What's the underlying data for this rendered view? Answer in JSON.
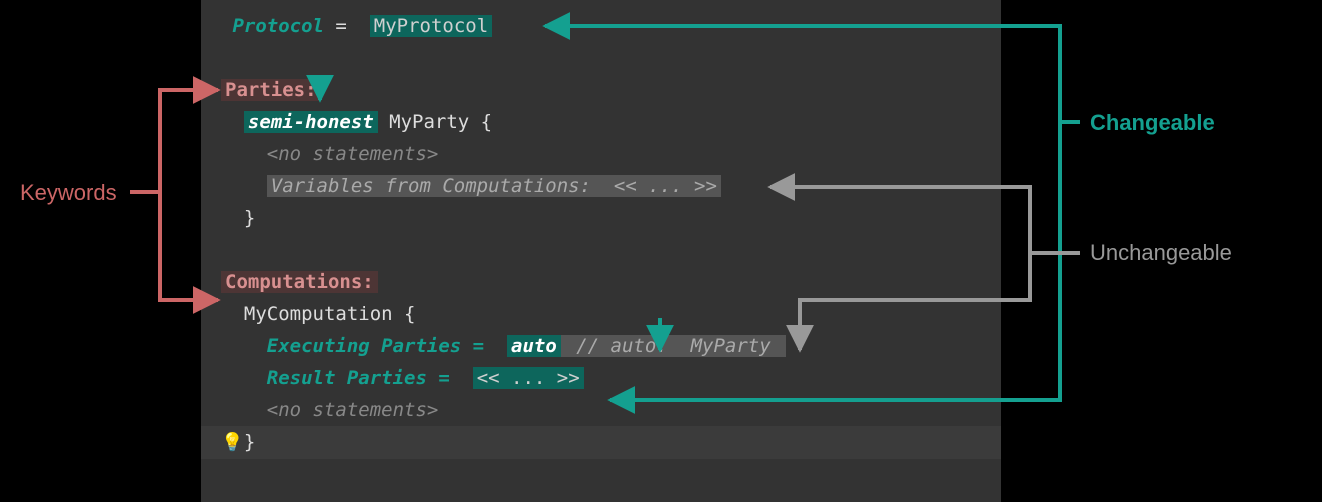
{
  "labels": {
    "keywords": "Keywords",
    "changeable": "Changeable",
    "unchangeable": "Unchangeable"
  },
  "code": {
    "protocol_kw": "Protocol",
    "equals": " = ",
    "protocol_val": "MyProtocol",
    "parties_kw": "Parties:",
    "semi_honest": "semi-honest",
    "myparty": " MyParty {",
    "no_stmts": "<no statements>",
    "vars_from": "Variables from Computations:  << ... >>",
    "close": "}",
    "computations_kw": "Computations:",
    "mycomp": "MyComputation {",
    "exec_parties": "Executing Parties = ",
    "auto": "auto",
    "auto_comment": " // auto:  MyParty ",
    "result_parties": "Result Parties = ",
    "result_val": "<< ... >>"
  }
}
